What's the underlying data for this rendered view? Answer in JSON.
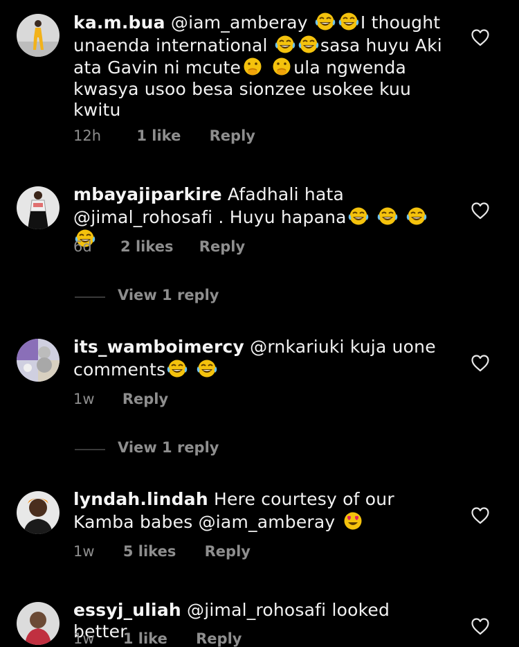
{
  "icons": {
    "laugh": "face-with-tears-of-joy-icon",
    "hush": "face-with-hand-over-mouth-icon",
    "love": "heart-eyes-icon",
    "like": "heart-outline-icon"
  },
  "colors": {
    "background": "#000000",
    "text": "#f5f5f5",
    "meta": "#8e8e8e"
  },
  "comments": [
    {
      "username": "ka.m.bua",
      "mention": "@iam_amberay",
      "seg1": "I thought unaenda international",
      "seg2": "sasa huyu Aki ata Gavin ni mcute",
      "seg3": "ula ngwenda kwasya usoo besa sionzee usokee kuu kwitu",
      "time": "12h",
      "likes": "1 like",
      "reply": "Reply"
    },
    {
      "username": "mbayajiparkire",
      "text": "Afadhali hata @jimal_rohosafi . Huyu hapana",
      "time": "6d",
      "likes": "2 likes",
      "reply": "Reply",
      "view_replies": "View 1 reply"
    },
    {
      "username": "its_wamboimercy",
      "text": "@rnkariuki kuja uone comments",
      "time": "1w",
      "reply": "Reply",
      "view_replies": "View 1 reply"
    },
    {
      "username": "lyndah.lindah",
      "text": "Here courtesy of our Kamba babes @iam_amberay",
      "time": "1w",
      "likes": "5 likes",
      "reply": "Reply"
    },
    {
      "username": "essyj_uliah",
      "text": "@jimal_rohosafi looked better.",
      "time": "1w",
      "likes": "1 like",
      "reply": "Reply"
    }
  ]
}
